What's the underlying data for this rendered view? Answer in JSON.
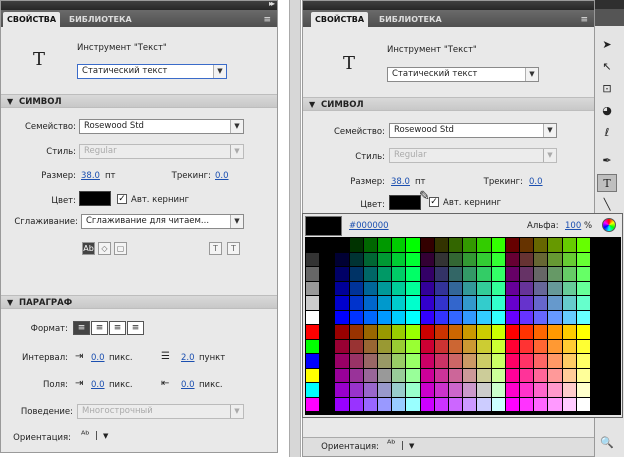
{
  "left_panel": {
    "tabs": [
      "СВОЙСТВА",
      "БИБЛИОТЕКА"
    ],
    "tool_icon": "T",
    "tool_name": "Инструмент \"Текст\"",
    "text_type": "Статический текст",
    "symbol_section": "СИМВОЛ",
    "family_label": "Семейство:",
    "family_value": "Rosewood Std",
    "style_label": "Стиль:",
    "style_value": "Regular",
    "size_label": "Размер:",
    "size_value": "38.0",
    "size_unit": "пт",
    "tracking_label": "Трекинг:",
    "tracking_value": "0.0",
    "color_label": "Цвет:",
    "kerning_label": "Авт. кернинг",
    "antialias_label": "Сглаживание:",
    "antialias_value": "Сглаживание для читаем...",
    "paragraph_section": "ПАРАГРАФ",
    "format_label": "Формат:",
    "spacing_label": "Интервал:",
    "spacing_indent": "0.0",
    "spacing_unit": "пикс.",
    "line_spacing": "2.0",
    "line_spacing_unit": "пункт",
    "margins_label": "Поля:",
    "margin_left": "0.0",
    "margin_right": "0.0",
    "margins_unit": "пикс.",
    "behavior_label": "Поведение:",
    "behavior_value": "Многострочный",
    "orientation_label": "Ориентация:"
  },
  "right_panel": {
    "tabs": [
      "СВОЙСТВА",
      "БИБЛИОТЕКА"
    ],
    "tool_icon": "T",
    "tool_name": "Инструмент \"Текст\"",
    "text_type": "Статический текст",
    "symbol_section": "СИМВОЛ",
    "family_label": "Семейство:",
    "family_value": "Rosewood Std",
    "style_label": "Стиль:",
    "style_value": "Regular",
    "size_label": "Размер:",
    "size_value": "38.0",
    "size_unit": "пт",
    "tracking_label": "Трекинг:",
    "tracking_value": "0.0",
    "color_label": "Цвет:",
    "kerning_label": "Авт. кернинг",
    "orientation_label": "Ориентация:"
  },
  "color_picker": {
    "hex_value": "#000000",
    "alpha_label": "Альфа:",
    "alpha_value": "100",
    "alpha_unit": "%"
  },
  "colors": {
    "tab_bar": "#555555",
    "panel_bg": "#e9e9e9",
    "link": "#1b4fb0",
    "selected_swatch": "#000000"
  }
}
